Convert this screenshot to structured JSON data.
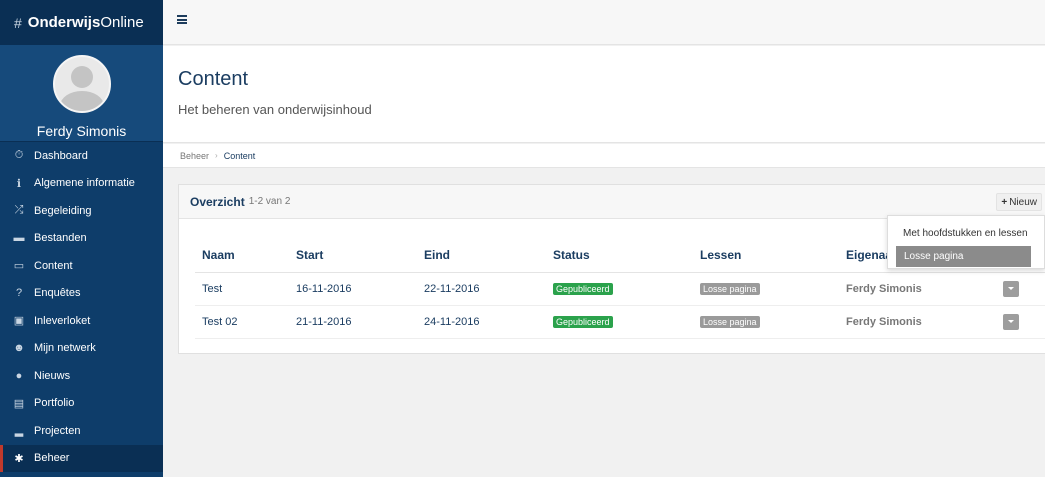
{
  "brand": {
    "hash": "#",
    "name_bold": "Onderwijs",
    "name_regular": "Online"
  },
  "user": {
    "name": "Ferdy Simonis"
  },
  "sidebar": {
    "items": [
      {
        "label": "Dashboard",
        "icon": "stopwatch-icon",
        "glyph": "⏱"
      },
      {
        "label": "Algemene informatie",
        "icon": "info-icon",
        "glyph": "ℹ"
      },
      {
        "label": "Begeleiding",
        "icon": "shuffle-icon",
        "glyph": "⤮"
      },
      {
        "label": "Bestanden",
        "icon": "folder-icon",
        "glyph": "▬"
      },
      {
        "label": "Content",
        "icon": "book-icon",
        "glyph": "▭"
      },
      {
        "label": "Enquêtes",
        "icon": "question-icon",
        "glyph": "?"
      },
      {
        "label": "Inleverloket",
        "icon": "inbox-icon",
        "glyph": "▣"
      },
      {
        "label": "Mijn netwerk",
        "icon": "users-icon",
        "glyph": "☻"
      },
      {
        "label": "Nieuws",
        "icon": "globe-icon",
        "glyph": "●"
      },
      {
        "label": "Portfolio",
        "icon": "briefcase-icon",
        "glyph": "▤"
      },
      {
        "label": "Projecten",
        "icon": "laptop-icon",
        "glyph": "▂"
      },
      {
        "label": "Beheer",
        "icon": "gear-icon",
        "glyph": "✱"
      }
    ],
    "active": "Beheer"
  },
  "header": {
    "title": "Content",
    "subtitle": "Het beheren van onderwijsinhoud"
  },
  "breadcrumb": {
    "parent": "Beheer",
    "separator": "›",
    "current": "Content"
  },
  "panel": {
    "title": "Overzicht",
    "count": "1-2 van 2",
    "new_button": "Nieuw",
    "new_plus": "+",
    "columns": [
      "Naam",
      "Start",
      "Eind",
      "Status",
      "Lessen",
      "Eigenaar"
    ],
    "rows": [
      {
        "naam": "Test",
        "start": "16-11-2016",
        "eind": "22-11-2016",
        "status": "Gepubliceerd",
        "lessen": "Losse pagina",
        "eigenaar": "Ferdy Simonis"
      },
      {
        "naam": "Test 02",
        "start": "21-11-2016",
        "eind": "24-11-2016",
        "status": "Gepubliceerd",
        "lessen": "Losse pagina",
        "eigenaar": "Ferdy Simonis"
      }
    ]
  },
  "dropdown": {
    "items": [
      "Met hoofdstukken en lessen",
      "Losse pagina"
    ],
    "highlighted": "Losse pagina"
  },
  "colors": {
    "sidebar": "#0e3d6a",
    "accent_text": "#1b3d61",
    "published": "#2ba24c",
    "label_gray": "#9a9a9a",
    "active_marker": "#c0392b"
  }
}
